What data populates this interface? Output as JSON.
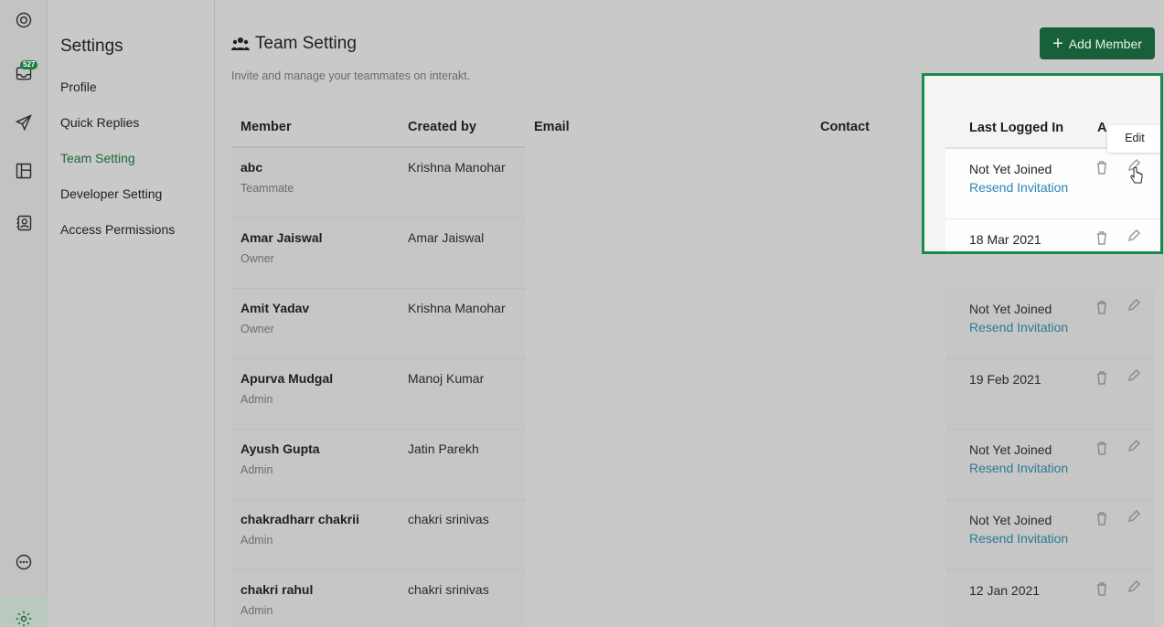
{
  "rail": {
    "badge_count": "527",
    "icons": [
      "chat-logo-icon",
      "inbox-icon",
      "send-icon",
      "layout-icon",
      "contacts-icon",
      "help-chat-icon",
      "settings-icon"
    ]
  },
  "menu": {
    "title": "Settings",
    "items": [
      {
        "label": "Profile",
        "active": false
      },
      {
        "label": "Quick Replies",
        "active": false
      },
      {
        "label": "Team Setting",
        "active": true
      },
      {
        "label": "Developer Setting",
        "active": false
      },
      {
        "label": "Access Permissions",
        "active": false
      }
    ]
  },
  "page": {
    "title": "Team Setting",
    "subtitle": "Invite and manage your teammates on interakt.",
    "add_button": "Add Member"
  },
  "table": {
    "headers": {
      "member": "Member",
      "created_by": "Created by",
      "email": "Email",
      "contact": "Contact",
      "last_logged_in": "Last Logged In",
      "actions": "A"
    },
    "rows": [
      {
        "name": "abc",
        "role": "Teammate",
        "created_by": "Krishna Manohar",
        "status": "Not Yet Joined",
        "resend": "Resend Invitation"
      },
      {
        "name": "Amar Jaiswal",
        "role": "Owner",
        "created_by": "Amar Jaiswal",
        "status": "18 Mar 2021",
        "resend": ""
      },
      {
        "name": "Amit Yadav",
        "role": "Owner",
        "created_by": "Krishna Manohar",
        "status": "Not Yet Joined",
        "resend": "Resend Invitation"
      },
      {
        "name": "Apurva Mudgal",
        "role": "Admin",
        "created_by": "Manoj Kumar",
        "status": "19 Feb 2021",
        "resend": ""
      },
      {
        "name": "Ayush Gupta",
        "role": "Admin",
        "created_by": "Jatin Parekh",
        "status": "Not Yet Joined",
        "resend": "Resend Invitation"
      },
      {
        "name": "chakradharr chakrii",
        "role": "Admin",
        "created_by": "chakri srinivas",
        "status": "Not Yet Joined",
        "resend": "Resend Invitation"
      },
      {
        "name": "chakri rahul",
        "role": "Admin",
        "created_by": "chakri srinivas",
        "status": "12 Jan 2021",
        "resend": ""
      }
    ]
  },
  "tooltip": {
    "edit": "Edit"
  },
  "colors": {
    "brand_green": "#17603a",
    "highlight_border": "#1a8a4f",
    "link_blue": "#2b86b5"
  }
}
